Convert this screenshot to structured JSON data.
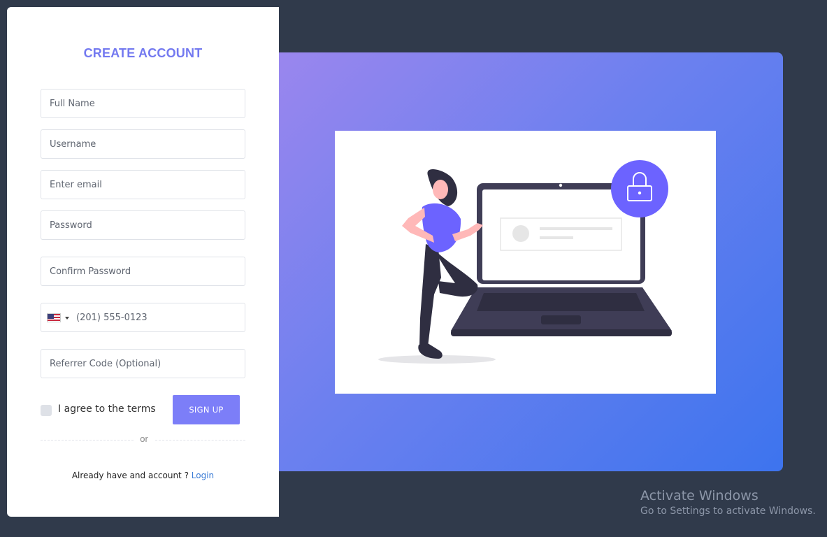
{
  "form": {
    "title": "CREATE ACCOUNT",
    "fields": {
      "full_name": "Full Name",
      "username": "Username",
      "email": "Enter email",
      "password": "Password",
      "confirm_password": "Confirm Password",
      "phone": "(201) 555-0123",
      "referrer": "Referrer Code (Optional)"
    },
    "phone_country_icon": "us-flag-icon",
    "terms_label": "I agree to the terms",
    "signup_label": "SIGN UP",
    "divider_text": "or",
    "login_prompt": "Already have and account ?",
    "login_link": "Login"
  },
  "hero": {
    "illustration": "woman-leaning-on-laptop-with-lock-illustration",
    "gradient": [
      "#9a86ee",
      "#3d74ee"
    ]
  },
  "watermark": {
    "title": "Activate Windows",
    "subtitle": "Go to Settings to activate Windows."
  },
  "colors": {
    "background": "#303a4b",
    "accent": "#7c7ef8",
    "title": "#7379f0",
    "link": "#3a7bd5"
  }
}
